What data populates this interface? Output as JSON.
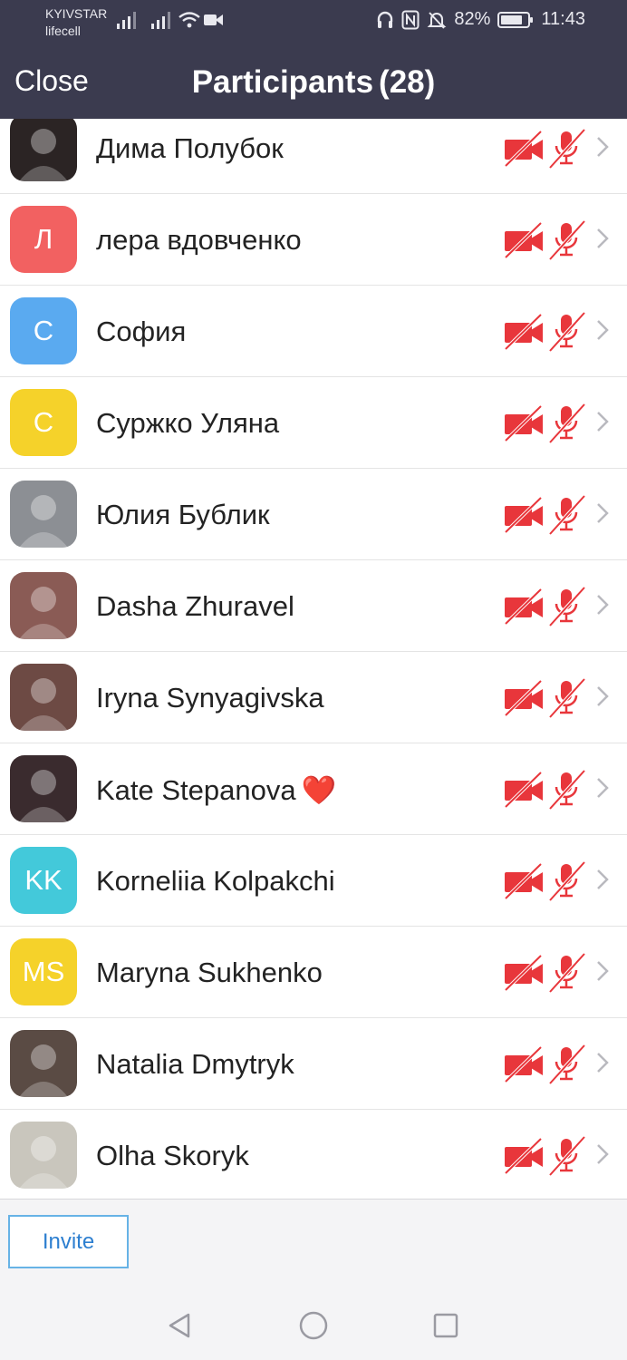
{
  "status_bar": {
    "carrier_1": "KYIVSTAR",
    "carrier_2": "lifecell",
    "battery_percent": "82%",
    "battery_level": 0.82,
    "time": "11:43",
    "icons": [
      "signal-icon",
      "signal-icon",
      "wifi-icon",
      "video-icon",
      "headphones-icon",
      "nfc-icon",
      "bell-off-icon",
      "battery-icon"
    ]
  },
  "header": {
    "close_label": "Close",
    "title": "Participants",
    "count": "(28)"
  },
  "participants": [
    {
      "name": "Дима Полубок",
      "avatar_type": "photo",
      "avatar_text": "",
      "color": "#2b2424"
    },
    {
      "name": "лера вдовченко",
      "avatar_type": "initials",
      "avatar_text": "Л",
      "color": "#f26161"
    },
    {
      "name": "София",
      "avatar_type": "initials",
      "avatar_text": "С",
      "color": "#5aaaf0"
    },
    {
      "name": "Суржко Уляна",
      "avatar_type": "initials",
      "avatar_text": "С",
      "color": "#f5d22a"
    },
    {
      "name": "Юлия Бублик",
      "avatar_type": "photo",
      "avatar_text": "",
      "color": "#8c8f94"
    },
    {
      "name": "Dasha Zhuravel",
      "avatar_type": "photo",
      "avatar_text": "",
      "color": "#8a5b55"
    },
    {
      "name": "Iryna Synyagivska",
      "avatar_type": "photo",
      "avatar_text": "",
      "color": "#6d4a44"
    },
    {
      "name": "Kate Stepanova",
      "avatar_type": "photo",
      "avatar_text": "",
      "color": "#3a2b2e",
      "emoji": "❤️"
    },
    {
      "name": "Korneliia Kolpakchi",
      "avatar_type": "initials",
      "avatar_text": "KK",
      "color": "#43c9da"
    },
    {
      "name": "Maryna Sukhenko",
      "avatar_type": "initials",
      "avatar_text": "MS",
      "color": "#f5d22a"
    },
    {
      "name": "Natalia Dmytryk",
      "avatar_type": "photo",
      "avatar_text": "",
      "color": "#5a4b44"
    },
    {
      "name": "Olha Skoryk",
      "avatar_type": "photo",
      "avatar_text": "",
      "color": "#c9c6bd"
    }
  ],
  "row_icons": {
    "video": "video-off-icon",
    "mic": "mic-off-icon",
    "chevron": "chevron-right-icon",
    "muted_color": "#e8363b"
  },
  "footer": {
    "invite_label": "Invite"
  },
  "colors": {
    "header_bg": "#3b3b4f",
    "invite_border": "#67b3e6",
    "invite_text": "#2d7fd0"
  },
  "nav": {
    "buttons": [
      "back-icon",
      "home-icon",
      "recents-icon"
    ]
  }
}
